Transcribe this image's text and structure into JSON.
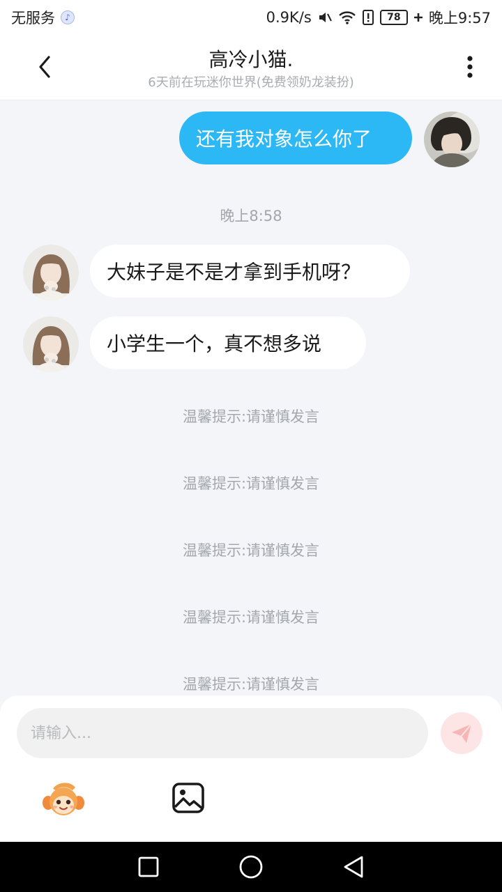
{
  "status_bar": {
    "carrier": "无服务",
    "net_speed": "0.9K/s",
    "battery": "78",
    "time": "晚上9:57"
  },
  "header": {
    "title": "高冷小猫.",
    "subtitle": "6天前在玩迷你世界(免费领奶龙装扮)"
  },
  "messages": [
    {
      "from": "me",
      "text": "还有我对象怎么你了"
    },
    {
      "type": "time",
      "text": "晚上8:58"
    },
    {
      "from": "them",
      "text": "大妹子是不是才拿到手机呀？"
    },
    {
      "from": "them",
      "text": "小学生一个，真不想多说"
    }
  ],
  "notices": [
    "温馨提示:请谨慎发言",
    "温馨提示:请谨慎发言",
    "温馨提示:请谨慎发言",
    "温馨提示:请谨慎发言",
    "温馨提示:请谨慎发言"
  ],
  "input": {
    "placeholder": "请输入..."
  },
  "icons": {
    "back": "chevron-left-icon",
    "more": "more-vertical-icon",
    "send": "send-plane-icon",
    "emoji": "mascot-emoji-icon",
    "image": "image-icon"
  },
  "colors": {
    "my_bubble": "#2bb8f5",
    "their_bubble": "#ffffff",
    "background": "#f3f5f9",
    "send_button": "#fde5e5"
  }
}
